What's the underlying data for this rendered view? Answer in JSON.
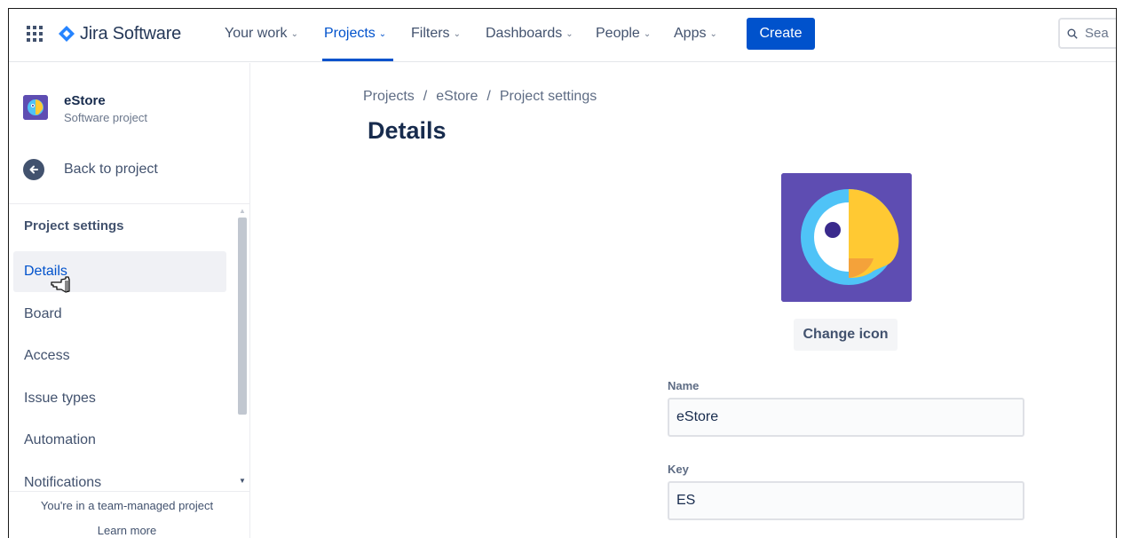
{
  "app": {
    "product_name": "Jira Software",
    "colors": {
      "brand": "#0052cc",
      "project_icon_bg": "#5e4db2",
      "text": "#172b4d",
      "muted": "#5e6c84"
    }
  },
  "topnav": {
    "items": [
      {
        "label": "Your work",
        "icon": "chevron-down-icon",
        "active": false
      },
      {
        "label": "Projects",
        "icon": "chevron-down-icon",
        "active": true
      },
      {
        "label": "Filters",
        "icon": "chevron-down-icon",
        "active": false
      },
      {
        "label": "Dashboards",
        "icon": "chevron-down-icon",
        "active": false
      },
      {
        "label": "People",
        "icon": "chevron-down-icon",
        "active": false
      },
      {
        "label": "Apps",
        "icon": "chevron-down-icon",
        "active": false
      }
    ],
    "create_label": "Create",
    "search_placeholder": "Sea"
  },
  "sidebar": {
    "project": {
      "name": "eStore",
      "type": "Software project"
    },
    "back_label": "Back to project",
    "section_title": "Project settings",
    "items": [
      {
        "label": "Details",
        "active": true
      },
      {
        "label": "Board",
        "active": false
      },
      {
        "label": "Access",
        "active": false
      },
      {
        "label": "Issue types",
        "active": false
      },
      {
        "label": "Automation",
        "active": false
      },
      {
        "label": "Notifications",
        "active": false
      }
    ],
    "footer_note": "You're in a team-managed project",
    "learn_more": "Learn more"
  },
  "main": {
    "breadcrumb": [
      "Projects",
      "eStore",
      "Project settings"
    ],
    "breadcrumb_separator": "/",
    "title": "Details",
    "change_icon_label": "Change icon",
    "fields": {
      "name": {
        "label": "Name",
        "value": "eStore"
      },
      "key": {
        "label": "Key",
        "value": "ES"
      }
    }
  }
}
